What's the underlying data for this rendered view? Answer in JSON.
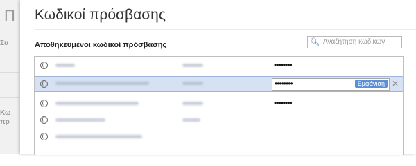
{
  "background": {
    "title_fragment": "Π",
    "label_su": "Συ",
    "label_k_line1": "Κω",
    "label_k_line2": "πρ"
  },
  "dialog": {
    "title": "Κωδικοί πρόσβασης",
    "section_label": "Αποθηκευμένοι κωδικοί πρόσβασης",
    "search_placeholder": "Αναζήτηση κωδικών",
    "show_button_label": "Εμφάνιση",
    "rows": [
      {
        "password_mask": "••••••••",
        "selected": false
      },
      {
        "password_mask": "••••••••",
        "selected": true
      },
      {
        "password_mask": "••••••••",
        "selected": false
      },
      {
        "password_mask": "",
        "selected": false
      },
      {
        "password_mask": "",
        "selected": false
      }
    ]
  }
}
